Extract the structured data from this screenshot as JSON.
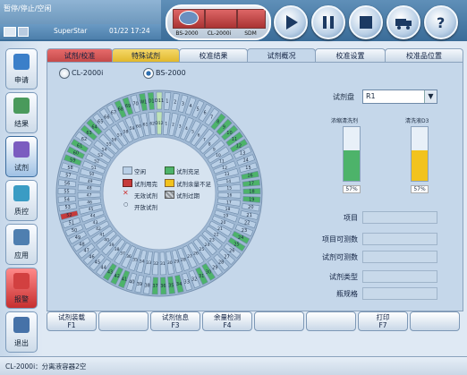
{
  "status": {
    "text": "暂停/停止/空闲"
  },
  "header": {
    "user": "SuperStar",
    "datetime": "01/22 17:24"
  },
  "instruments": [
    "BS-2000",
    "CL-2000i",
    "SDM"
  ],
  "colors": {
    "accent": "#3a6c98",
    "full": "#4db36a",
    "empty": "#b9cfe6",
    "used": "#c63b3b",
    "low": "#f2c31e",
    "expired": "#8a8f94",
    "selected": "#bfe3b8"
  },
  "sidebar": [
    {
      "label": "申请",
      "icon": "request-icon"
    },
    {
      "label": "结果",
      "icon": "result-icon"
    },
    {
      "label": "试剂",
      "icon": "reagent-icon"
    },
    {
      "label": "质控",
      "icon": "qc-icon"
    },
    {
      "label": "应用",
      "icon": "app-icon"
    },
    {
      "label": "报警",
      "icon": "alarm-icon"
    },
    {
      "label": "退出",
      "icon": "exit-icon"
    }
  ],
  "tabs": [
    "试剂/校准",
    "特殊试剂",
    "校准结果",
    "试剂概况",
    "校准设置",
    "校准品位置"
  ],
  "modules": {
    "a": "CL-2000i",
    "b": "BS-2000"
  },
  "legend": {
    "empty": "空闲",
    "full": "试剂充足",
    "used": "试剂用完",
    "low": "试剂余量不足",
    "invalid": "无效试剂",
    "expired": "试剂过期",
    "open": "开放试剂"
  },
  "rightpanel": {
    "disk_label": "试剂盘",
    "disk_value": "R1",
    "bottle1_label": "浓缩清洗剂",
    "bottle1_pct": "57%",
    "bottle1_fill": 0.57,
    "bottle2_label": "清洗液D3",
    "bottle2_pct": "57%",
    "bottle2_fill": 0.57,
    "fields": [
      "项目",
      "项目可测数",
      "试剂可测数",
      "试剂类型",
      "瓶规格"
    ]
  },
  "outer_ring": [
    {
      "n": "D11",
      "c": "sel"
    },
    {
      "n": "1",
      "c": "e"
    },
    {
      "n": "2",
      "c": "e"
    },
    {
      "n": "3",
      "c": "e"
    },
    {
      "n": "4",
      "c": "e"
    },
    {
      "n": "5",
      "c": "e"
    },
    {
      "n": "6",
      "c": "e"
    },
    {
      "n": "7",
      "c": "e"
    },
    {
      "n": "8",
      "c": "f"
    },
    {
      "n": "9",
      "c": "f"
    },
    {
      "n": "10",
      "c": "f"
    },
    {
      "n": "11",
      "c": "f"
    },
    {
      "n": "12",
      "c": "f"
    },
    {
      "n": "13",
      "c": "e"
    },
    {
      "n": "14",
      "c": "e"
    },
    {
      "n": "15",
      "c": "e"
    },
    {
      "n": "16",
      "c": "f"
    },
    {
      "n": "17",
      "c": "f"
    },
    {
      "n": "18",
      "c": "f"
    },
    {
      "n": "19",
      "c": "f"
    },
    {
      "n": "20",
      "c": "e"
    },
    {
      "n": "21",
      "c": "e"
    },
    {
      "n": "22",
      "c": "e"
    },
    {
      "n": "23",
      "c": "e"
    },
    {
      "n": "24",
      "c": "f"
    },
    {
      "n": "25",
      "c": "f"
    },
    {
      "n": "26",
      "c": "e"
    },
    {
      "n": "27",
      "c": "e"
    },
    {
      "n": "28",
      "c": "e"
    },
    {
      "n": "29",
      "c": "e"
    },
    {
      "n": "30",
      "c": "f"
    },
    {
      "n": "31",
      "c": "f"
    },
    {
      "n": "32",
      "c": "e"
    },
    {
      "n": "33",
      "c": "e"
    },
    {
      "n": "34",
      "c": "f"
    },
    {
      "n": "35",
      "c": "f"
    },
    {
      "n": "36",
      "c": "f"
    },
    {
      "n": "37",
      "c": "f"
    },
    {
      "n": "38",
      "c": "e"
    },
    {
      "n": "39",
      "c": "e"
    },
    {
      "n": "40",
      "c": "e"
    },
    {
      "n": "41",
      "c": "f"
    },
    {
      "n": "42",
      "c": "f"
    },
    {
      "n": "43",
      "c": "f"
    },
    {
      "n": "44",
      "c": "e"
    },
    {
      "n": "45",
      "c": "e"
    },
    {
      "n": "46",
      "c": "e"
    },
    {
      "n": "47",
      "c": "e"
    },
    {
      "n": "48",
      "c": "e"
    },
    {
      "n": "49",
      "c": "e"
    },
    {
      "n": "50",
      "c": "e"
    },
    {
      "n": "51",
      "c": "e"
    },
    {
      "n": "52",
      "c": "u"
    },
    {
      "n": "53",
      "c": "e"
    },
    {
      "n": "54",
      "c": "e"
    },
    {
      "n": "55",
      "c": "e"
    },
    {
      "n": "56",
      "c": "e"
    },
    {
      "n": "57",
      "c": "e"
    },
    {
      "n": "58",
      "c": "e"
    },
    {
      "n": "59",
      "c": "f"
    },
    {
      "n": "60",
      "c": "f"
    },
    {
      "n": "61",
      "c": "f"
    },
    {
      "n": "62",
      "c": "e"
    },
    {
      "n": "63",
      "c": "f"
    },
    {
      "n": "64",
      "c": "f"
    },
    {
      "n": "65",
      "c": "e"
    },
    {
      "n": "66",
      "c": "e"
    },
    {
      "n": "67",
      "c": "e"
    },
    {
      "n": "68",
      "c": "f"
    },
    {
      "n": "69",
      "c": "f"
    },
    {
      "n": "70",
      "c": "e"
    },
    {
      "n": "W1",
      "c": "f"
    },
    {
      "n": "D1",
      "c": "f"
    }
  ],
  "inner_ring": [
    {
      "n": "D12",
      "c": "sel"
    },
    {
      "n": "1",
      "c": "e"
    },
    {
      "n": "2",
      "c": "e"
    },
    {
      "n": "3",
      "c": "e"
    },
    {
      "n": "4",
      "c": "e"
    },
    {
      "n": "5",
      "c": "e"
    },
    {
      "n": "6",
      "c": "e"
    },
    {
      "n": "7",
      "c": "e"
    },
    {
      "n": "8",
      "c": "e"
    },
    {
      "n": "9",
      "c": "e"
    },
    {
      "n": "10",
      "c": "e"
    },
    {
      "n": "11",
      "c": "e"
    },
    {
      "n": "12",
      "c": "e"
    },
    {
      "n": "13",
      "c": "e"
    },
    {
      "n": "14",
      "c": "e"
    },
    {
      "n": "15",
      "c": "e"
    },
    {
      "n": "16",
      "c": "e"
    },
    {
      "n": "17",
      "c": "e"
    },
    {
      "n": "18",
      "c": "e"
    },
    {
      "n": "19",
      "c": "e"
    },
    {
      "n": "20",
      "c": "e"
    },
    {
      "n": "21",
      "c": "e"
    },
    {
      "n": "22",
      "c": "e"
    },
    {
      "n": "23",
      "c": "e"
    },
    {
      "n": "24",
      "c": "e"
    },
    {
      "n": "25",
      "c": "e"
    },
    {
      "n": "26",
      "c": "e"
    },
    {
      "n": "27",
      "c": "e"
    },
    {
      "n": "28",
      "c": "e"
    },
    {
      "n": "29",
      "c": "e"
    },
    {
      "n": "30",
      "c": "e"
    },
    {
      "n": "31",
      "c": "e"
    },
    {
      "n": "32",
      "c": "e"
    },
    {
      "n": "33",
      "c": "e"
    },
    {
      "n": "34",
      "c": "e"
    },
    {
      "n": "35",
      "c": "e"
    },
    {
      "n": "36",
      "c": "e"
    },
    {
      "n": "37",
      "c": "e"
    },
    {
      "n": "38",
      "c": "e"
    },
    {
      "n": "39",
      "c": "e"
    },
    {
      "n": "40",
      "c": "e"
    },
    {
      "n": "41",
      "c": "e"
    },
    {
      "n": "42",
      "c": "e"
    },
    {
      "n": "43",
      "c": "e"
    },
    {
      "n": "44",
      "c": "e"
    },
    {
      "n": "45",
      "c": "e"
    },
    {
      "n": "46",
      "c": "e"
    },
    {
      "n": "47",
      "c": "e"
    },
    {
      "n": "48",
      "c": "e"
    },
    {
      "n": "49",
      "c": "e"
    },
    {
      "n": "50",
      "c": "e"
    },
    {
      "n": "51",
      "c": "e"
    },
    {
      "n": "52",
      "c": "e"
    },
    {
      "n": "53",
      "c": "e"
    },
    {
      "n": "54",
      "c": "e"
    },
    {
      "n": "55",
      "c": "e"
    },
    {
      "n": "56",
      "c": "e"
    },
    {
      "n": "57",
      "c": "e"
    },
    {
      "n": "58",
      "c": "e"
    },
    {
      "n": "59",
      "c": "e"
    },
    {
      "n": "60",
      "c": "e"
    },
    {
      "n": "61",
      "c": "e"
    },
    {
      "n": "62",
      "c": "e"
    }
  ],
  "fkeys": [
    {
      "label": "试剂装载",
      "key": "F1"
    },
    {
      "label": "",
      "key": ""
    },
    {
      "label": "试剂信息",
      "key": "F3"
    },
    {
      "label": "余量检测",
      "key": "F4"
    },
    {
      "label": "",
      "key": ""
    },
    {
      "label": "",
      "key": ""
    },
    {
      "label": "打印",
      "key": "F7"
    },
    {
      "label": "",
      "key": ""
    }
  ],
  "footer": {
    "text": "CL-2000i：分离液容器2空"
  }
}
